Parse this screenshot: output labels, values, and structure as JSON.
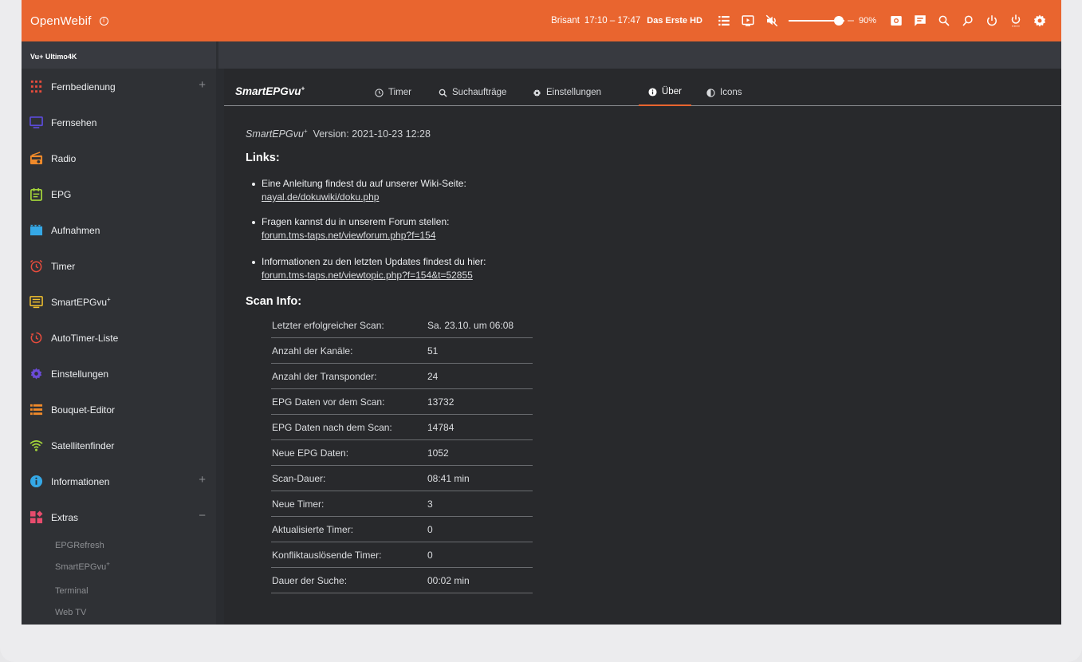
{
  "topbar": {
    "brand": "OpenWebif",
    "now_show": "Brisant",
    "now_time": "17:10 – 17:47",
    "now_channel": "Das Erste HD",
    "volume_level": 0.9,
    "volume_text": "90%",
    "accent_color": "#e9652f",
    "icons": [
      "list-icon",
      "screen-icon",
      "mute-icon",
      "screenshot-icon",
      "message-icon",
      "search-icon",
      "search-epg-icon",
      "power-icon",
      "standby-icon",
      "settings-icon"
    ]
  },
  "device": {
    "name": "Vu+ Ultimo4K"
  },
  "sidebar": {
    "items": [
      {
        "label": "Fernbedienung",
        "icon": "remote-icon",
        "color": "#e84c3d",
        "expand": "+"
      },
      {
        "label": "Fernsehen",
        "icon": "tv-icon",
        "color": "#5b4bd8"
      },
      {
        "label": "Radio",
        "icon": "radio-icon",
        "color": "#f08a2a"
      },
      {
        "label": "EPG",
        "icon": "epg-icon",
        "color": "#a5d63a"
      },
      {
        "label": "Aufnahmen",
        "icon": "movie-icon",
        "color": "#35a8e6"
      },
      {
        "label": "Timer",
        "icon": "alarm-icon",
        "color": "#e84c3d"
      },
      {
        "label": "SmartEPGvu",
        "icon": "epg-list-icon",
        "color": "#f2c12e"
      },
      {
        "label": "AutoTimer-Liste",
        "icon": "autotimer-icon",
        "color": "#e84c3d"
      },
      {
        "label": "Einstellungen",
        "icon": "gear-icon",
        "color": "#6b4bd8"
      },
      {
        "label": "Bouquet-Editor",
        "icon": "bouquet-icon",
        "color": "#f08a2a"
      },
      {
        "label": "Satellitenfinder",
        "icon": "wifi-icon",
        "color": "#a5d63a"
      },
      {
        "label": "Informationen",
        "icon": "info-icon",
        "color": "#35a8e6",
        "expand": "+"
      },
      {
        "label": "Extras",
        "icon": "widgets-icon",
        "color": "#e84c6d",
        "expand": "−"
      }
    ],
    "sub_items": [
      "EPGRefresh",
      "SmartEPGvu",
      "Terminal",
      "Web TV"
    ]
  },
  "plugin": {
    "title": "SmartEPGvu",
    "sup": "+",
    "tabs": [
      {
        "label": "Timer",
        "icon": "clock-icon"
      },
      {
        "label": "Suchaufträge",
        "icon": "search-icon"
      },
      {
        "label": "Einstellungen",
        "icon": "gear-icon"
      },
      {
        "label": "Über",
        "icon": "info-icon",
        "active": true
      },
      {
        "label": "Icons",
        "icon": "contrast-icon"
      }
    ]
  },
  "about": {
    "version_prefix": "Version:",
    "version": "2021-10-23 12:28",
    "links_heading": "Links:",
    "links": [
      {
        "text": "Eine Anleitung findest du auf unserer Wiki-Seite:",
        "url": "nayal.de/dokuwiki/doku.php"
      },
      {
        "text": "Fragen kannst du in unserem Forum stellen:",
        "url": "forum.tms-taps.net/viewforum.php?f=154"
      },
      {
        "text": "Informationen zu den letzten Updates findest du hier:",
        "url": "forum.tms-taps.net/viewtopic.php?f=154&t=52855"
      }
    ],
    "scan_heading": "Scan Info:",
    "scan_rows": [
      {
        "k": "Letzter erfolgreicher Scan:",
        "v": "Sa. 23.10. um 06:08"
      },
      {
        "k": "Anzahl der Kanäle:",
        "v": "51"
      },
      {
        "k": "Anzahl der Transponder:",
        "v": "24"
      },
      {
        "k": "EPG Daten vor dem Scan:",
        "v": "13732"
      },
      {
        "k": "EPG Daten nach dem Scan:",
        "v": "14784"
      },
      {
        "k": "Neue EPG Daten:",
        "v": "1052"
      },
      {
        "k": "Scan-Dauer:",
        "v": "08:41 min"
      },
      {
        "k": "Neue Timer:",
        "v": "3"
      },
      {
        "k": "Aktualisierte Timer:",
        "v": "0"
      },
      {
        "k": "Konfliktauslösende Timer:",
        "v": "0"
      },
      {
        "k": "Dauer der Suche:",
        "v": "00:02 min"
      }
    ]
  }
}
